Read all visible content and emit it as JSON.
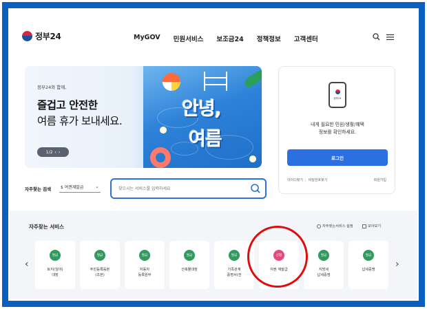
{
  "header": {
    "logo_text": "정부24",
    "nav": [
      "MyGOV",
      "민원서비스",
      "보조금24",
      "정책정보",
      "고객센터"
    ],
    "search_icon": "search-icon",
    "menu_icon": "hamburger-menu-icon"
  },
  "hero": {
    "subtitle": "정부24와 함께,",
    "title_line1": "즐겁고 안전한",
    "title_line2": "여름 휴가 보내세요.",
    "pager": {
      "current": "1/2",
      "prev": "‹",
      "next": "›"
    },
    "art_line1": "안녕,",
    "art_line2": "여름"
  },
  "login": {
    "phone_label": "정부24",
    "message_line1": "내게 필요한 민원/생활/혜택",
    "message_line2": "정보를 확인하세요.",
    "button": "로그인",
    "find_id": "아이디찾기",
    "find_pw": "비밀번호찾기",
    "signup": "회원가입"
  },
  "search": {
    "label": "자주찾는 검색",
    "select_value": "$ 여권재발급",
    "placeholder": "찾으시는 서비스를 입력하세요"
  },
  "services": {
    "title": "자주찾는 서비스",
    "settings": "자주찾는서비스 설정",
    "view_all": "모아보기",
    "items": [
      {
        "badge": "발급",
        "label": "토지(임야)\n대장"
      },
      {
        "badge": "발급",
        "label": "주민등록등본\n(초본)"
      },
      {
        "badge": "발급",
        "label": "자동차\n등록원부"
      },
      {
        "badge": "발급",
        "label": "건축물대장"
      },
      {
        "badge": "발급",
        "label": "가족관계\n증명서(전"
      },
      {
        "badge": "신청",
        "label": "여권 재발급"
      },
      {
        "badge": "발급",
        "label": "지방세\n납세증명"
      },
      {
        "badge": "발급",
        "label": "납세증명"
      }
    ]
  },
  "colors": {
    "frame_border": "#0a5fbf",
    "brand_blue": "#2c6fe0",
    "badge_green": "#2f9b5e",
    "badge_pink": "#e6477e",
    "highlight_red": "#e10b0b"
  }
}
